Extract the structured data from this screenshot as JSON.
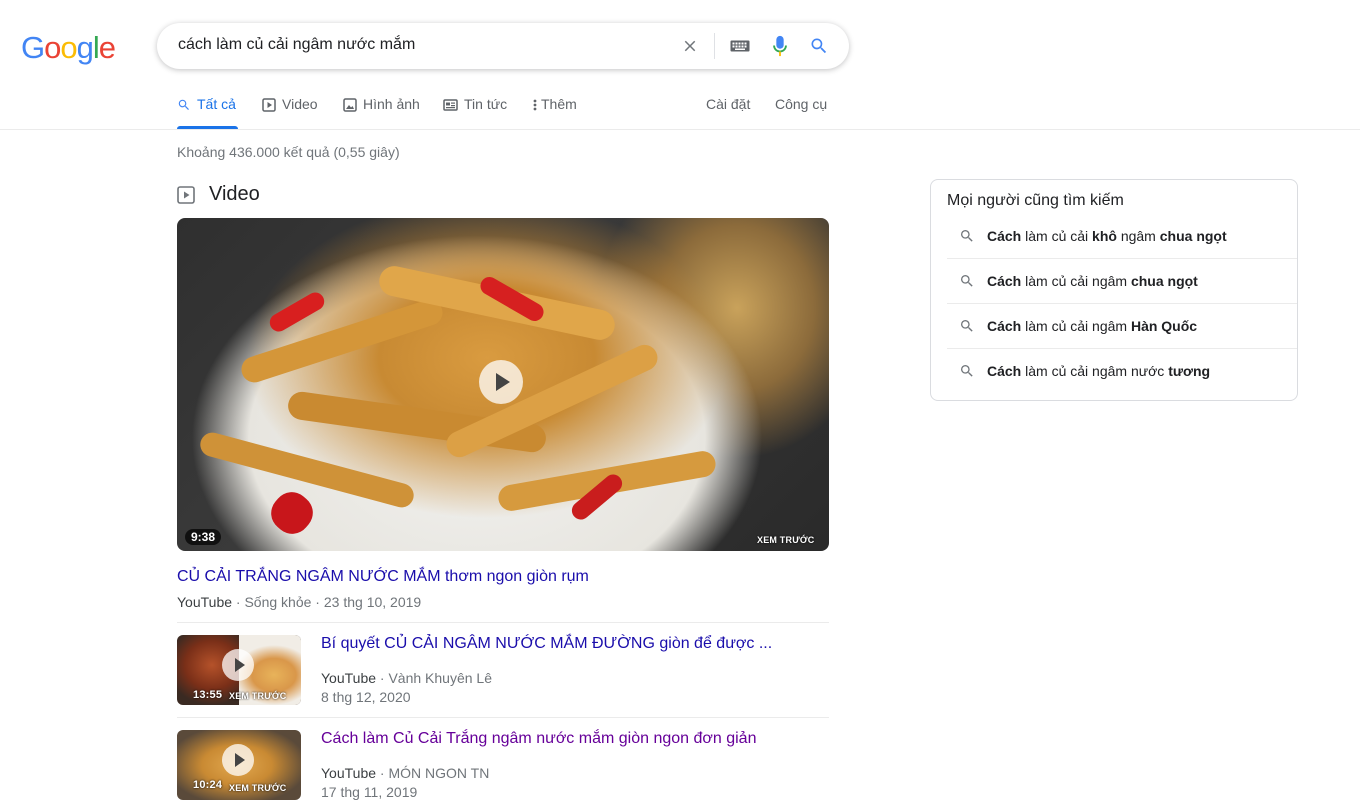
{
  "logo": {
    "letters": [
      "G",
      "o",
      "o",
      "g",
      "l",
      "e"
    ],
    "colors": [
      "#4285F4",
      "#EA4335",
      "#FBBC05",
      "#4285F4",
      "#34A853",
      "#EA4335"
    ]
  },
  "search": {
    "query": "cách làm củ cải ngâm nước mắm",
    "icons": [
      "close-icon",
      "keyboard-icon",
      "mic-icon",
      "search-icon"
    ]
  },
  "tabs": [
    {
      "label": "Tất cả",
      "icon": "search-icon",
      "active": true
    },
    {
      "label": "Video",
      "icon": "play-icon"
    },
    {
      "label": "Hình ảnh",
      "icon": "image-icon"
    },
    {
      "label": "Tin tức",
      "icon": "news-icon"
    },
    {
      "label": "Thêm",
      "icon": "more-vert-icon"
    }
  ],
  "tools": {
    "settings": "Cài đặt",
    "tools": "Công cụ"
  },
  "stats": "Khoảng 436.000 kết quả (0,55 giây)",
  "video_section": {
    "heading": "Video",
    "main": {
      "duration": "9:38",
      "preview": "XEM TRƯỚC",
      "title": "CỦ CẢI TRẮNG NGÂM NƯỚC MẮM thơm ngon giòn rụm",
      "source": "YouTube",
      "channel": "Sống khỏe",
      "date": "23 thg 10, 2019"
    },
    "items": [
      {
        "duration": "13:55",
        "preview": "XEM TRƯỚC",
        "title": "Bí quyết CỦ CẢI NGÂM NƯỚC MẮM ĐƯỜNG giòn để được ...",
        "source": "YouTube",
        "channel": "Vành Khuyên Lê",
        "date": "8 thg 12, 2020"
      },
      {
        "duration": "10:24",
        "preview": "XEM TRƯỚC",
        "title": "Cách làm Củ Cải Trắng ngâm nước mắm giòn ngon đơn giản",
        "source": "YouTube",
        "channel": "MÓN NGON TN",
        "date": "17 thg 11, 2019"
      }
    ]
  },
  "related": {
    "heading": "Mọi người cũng tìm kiếm",
    "items": [
      {
        "pre": "Cách",
        "mid": " làm củ cải ",
        "bold": "khô",
        "mid2": " ngâm ",
        "bold2": "chua ngọt"
      },
      {
        "pre": "Cách",
        "mid": " làm củ cải ngâm ",
        "bold": "chua ngọt",
        "mid2": "",
        "bold2": ""
      },
      {
        "pre": "Cách",
        "mid": " làm củ cải ngâm ",
        "bold": "Hàn Quốc",
        "mid2": "",
        "bold2": ""
      },
      {
        "pre": "Cách",
        "mid": " làm củ cải ngâm nước ",
        "bold": "tương",
        "mid2": "",
        "bold2": ""
      }
    ]
  }
}
